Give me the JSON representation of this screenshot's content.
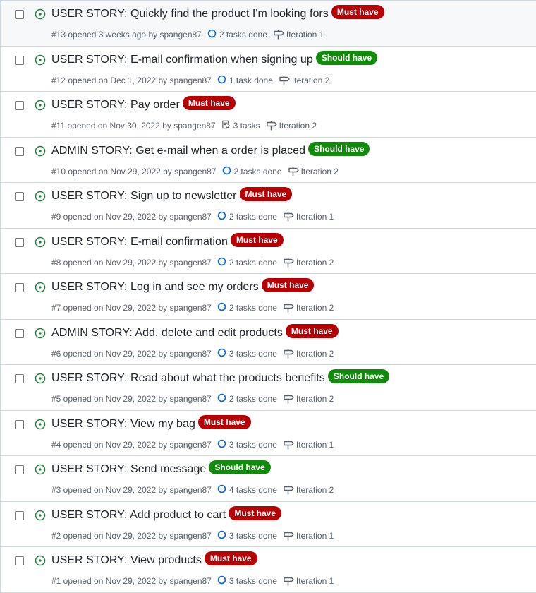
{
  "colors": {
    "must": "#b60205",
    "should": "#128a0c",
    "open": "#1a7f37",
    "task": "#0969da"
  },
  "issues": [
    {
      "title": "USER STORY: Quickly find the product I'm looking fors",
      "label": "Must have",
      "label_type": "must",
      "meta": "#13 opened 3 weeks ago by spangen87",
      "tasks": "2 tasks done",
      "task_icon": "progress-circle-icon",
      "milestone": "Iteration 1"
    },
    {
      "title": "USER STORY: E-mail confirmation when signing up",
      "label": "Should have",
      "label_type": "should",
      "meta": "#12 opened on Dec 1, 2022 by spangen87",
      "tasks": "1 task done",
      "task_icon": "progress-circle-icon",
      "milestone": "Iteration 2"
    },
    {
      "title": "USER STORY: Pay order",
      "label": "Must have",
      "label_type": "must",
      "meta": "#11 opened on Nov 30, 2022 by spangen87",
      "tasks": "3 tasks",
      "task_icon": "checklist-icon",
      "milestone": "Iteration 2"
    },
    {
      "title": "ADMIN STORY: Get e-mail when a order is placed",
      "label": "Should have",
      "label_type": "should",
      "meta": "#10 opened on Nov 29, 2022 by spangen87",
      "tasks": "2 tasks done",
      "task_icon": "progress-circle-icon",
      "milestone": "Iteration 2"
    },
    {
      "title": "USER STORY: Sign up to newsletter",
      "label": "Must have",
      "label_type": "must",
      "meta": "#9 opened on Nov 29, 2022 by spangen87",
      "tasks": "2 tasks done",
      "task_icon": "progress-circle-icon",
      "milestone": "Iteration 1"
    },
    {
      "title": "USER STORY: E-mail confirmation",
      "label": "Must have",
      "label_type": "must",
      "meta": "#8 opened on Nov 29, 2022 by spangen87",
      "tasks": "2 tasks done",
      "task_icon": "progress-circle-icon",
      "milestone": "Iteration 2"
    },
    {
      "title": "USER STORY: Log in and see my orders",
      "label": "Must have",
      "label_type": "must",
      "meta": "#7 opened on Nov 29, 2022 by spangen87",
      "tasks": "2 tasks done",
      "task_icon": "progress-circle-icon",
      "milestone": "Iteration 2"
    },
    {
      "title": "ADMIN STORY: Add, delete and edit products",
      "label": "Must have",
      "label_type": "must",
      "meta": "#6 opened on Nov 29, 2022 by spangen87",
      "tasks": "3 tasks done",
      "task_icon": "progress-circle-icon",
      "milestone": "Iteration 2"
    },
    {
      "title": "USER STORY: Read about what the products benefits",
      "label": "Should have",
      "label_type": "should",
      "meta": "#5 opened on Nov 29, 2022 by spangen87",
      "tasks": "2 tasks done",
      "task_icon": "progress-circle-icon",
      "milestone": "Iteration 2"
    },
    {
      "title": "USER STORY: View my bag",
      "label": "Must have",
      "label_type": "must",
      "meta": "#4 opened on Nov 29, 2022 by spangen87",
      "tasks": "3 tasks done",
      "task_icon": "progress-circle-icon",
      "milestone": "Iteration 1"
    },
    {
      "title": "USER STORY: Send message",
      "label": "Should have",
      "label_type": "should",
      "meta": "#3 opened on Nov 29, 2022 by spangen87",
      "tasks": "4 tasks done",
      "task_icon": "progress-circle-icon",
      "milestone": "Iteration 2"
    },
    {
      "title": "USER STORY: Add product to cart",
      "label": "Must have",
      "label_type": "must",
      "meta": "#2 opened on Nov 29, 2022 by spangen87",
      "tasks": "3 tasks done",
      "task_icon": "progress-circle-icon",
      "milestone": "Iteration 1"
    },
    {
      "title": "USER STORY: View products",
      "label": "Must have",
      "label_type": "must",
      "meta": "#1 opened on Nov 29, 2022 by spangen87",
      "tasks": "3 tasks done",
      "task_icon": "progress-circle-icon",
      "milestone": "Iteration 1"
    }
  ]
}
